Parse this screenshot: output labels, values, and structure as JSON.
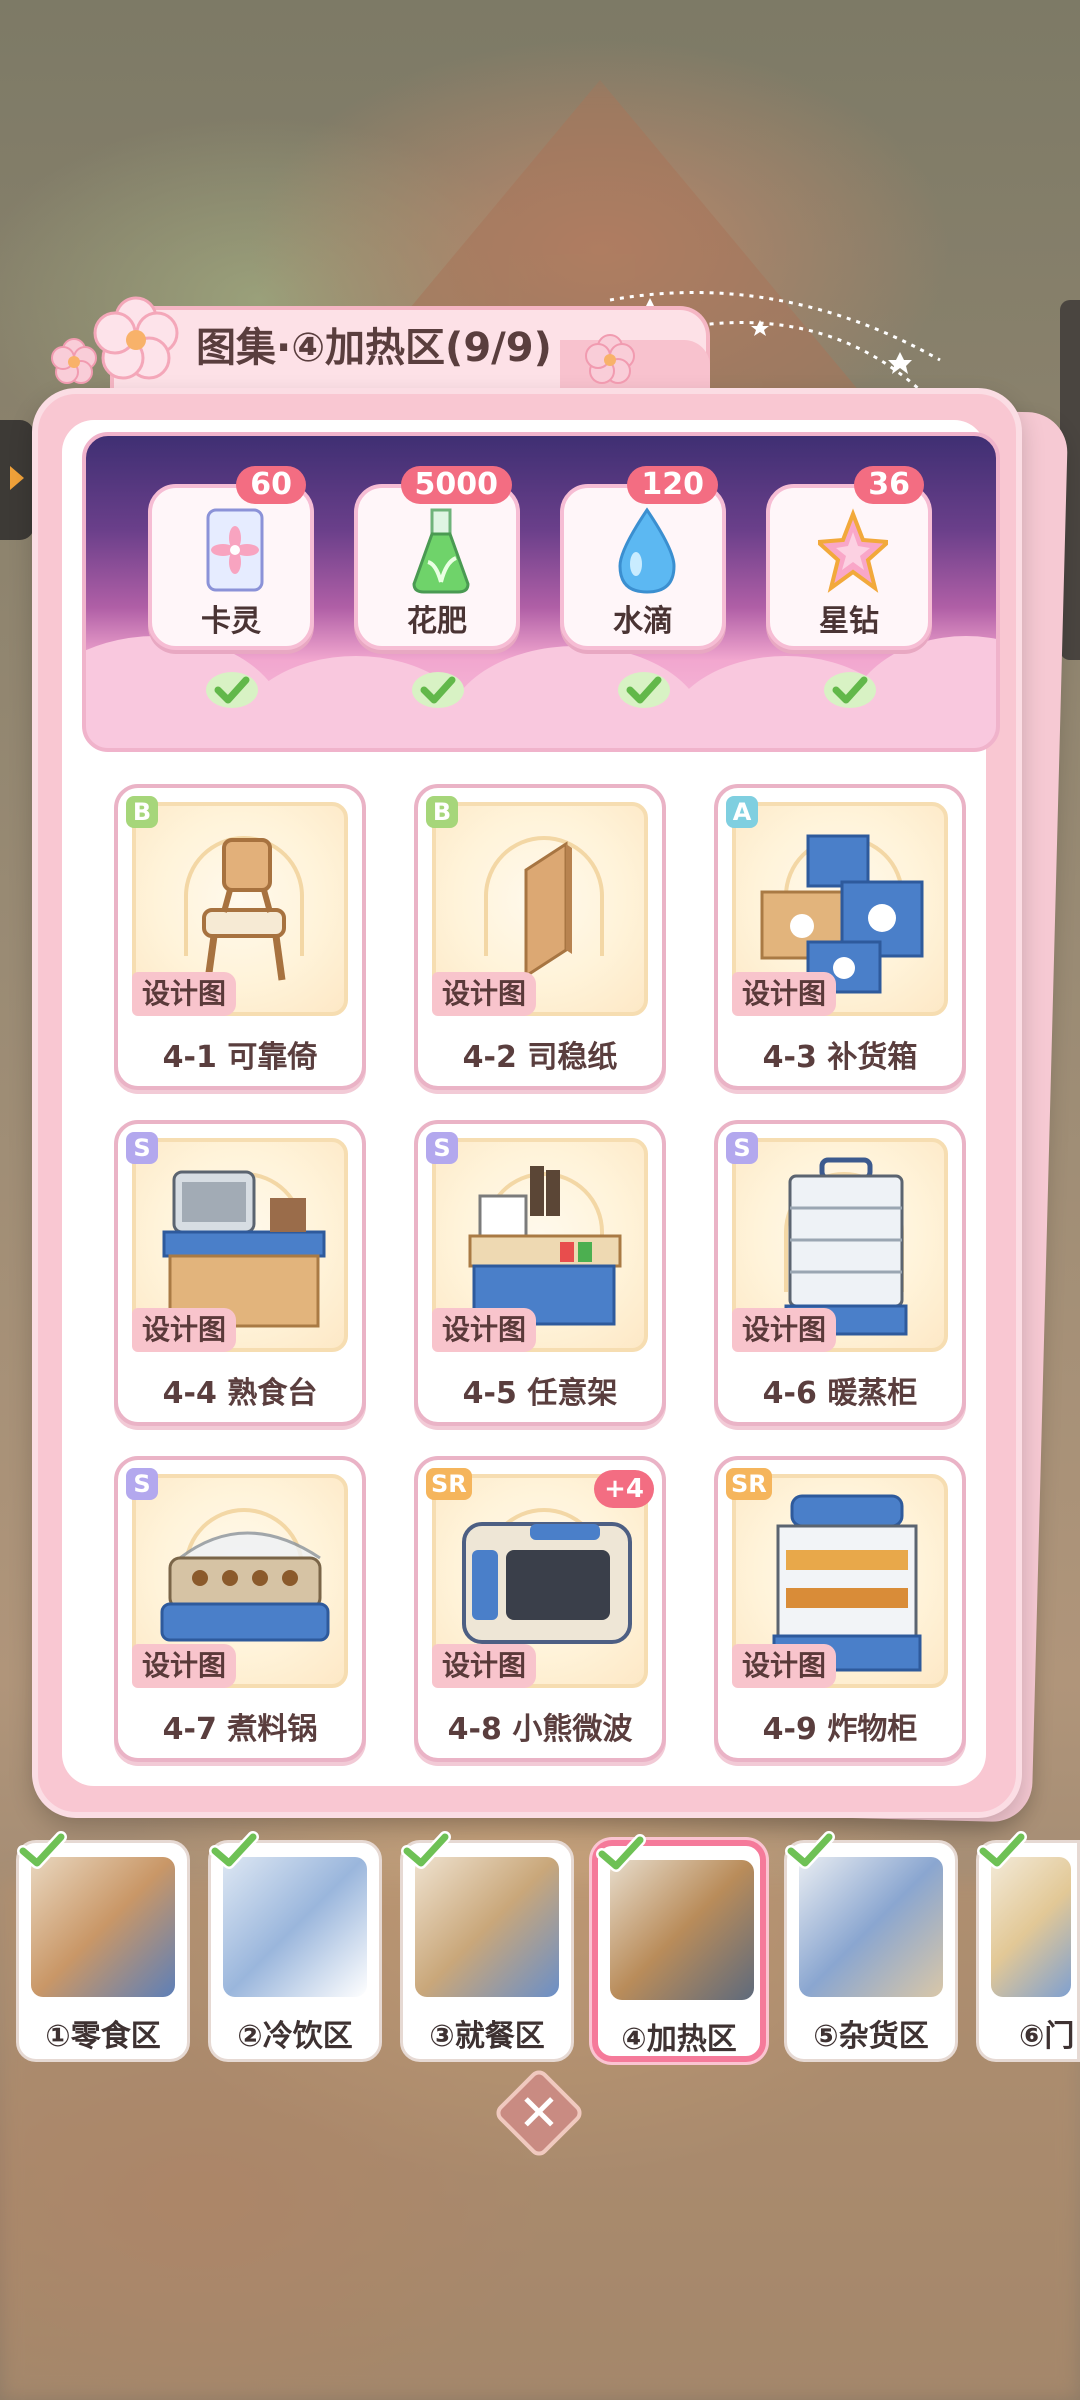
{
  "title": "图集·④加热区(9/9)",
  "rewards": [
    {
      "label": "卡灵",
      "count": "60",
      "icon": "card-icon",
      "claimed": true
    },
    {
      "label": "花肥",
      "count": "5000",
      "icon": "fertilizer-flask-icon",
      "claimed": true
    },
    {
      "label": "水滴",
      "count": "120",
      "icon": "water-drop-icon",
      "claimed": true
    },
    {
      "label": "星钻",
      "count": "36",
      "icon": "star-diamond-icon",
      "claimed": true
    }
  ],
  "items": [
    {
      "rarity": "B",
      "tag": "设计图",
      "name": "4-1 可靠倚",
      "icon": "chair-icon"
    },
    {
      "rarity": "B",
      "tag": "设计图",
      "name": "4-2 司稳纸",
      "icon": "board-icon"
    },
    {
      "rarity": "A",
      "tag": "设计图",
      "name": "4-3 补货箱",
      "icon": "boxes-icon"
    },
    {
      "rarity": "S",
      "tag": "设计图",
      "name": "4-4 熟食台",
      "icon": "deli-counter-icon"
    },
    {
      "rarity": "S",
      "tag": "设计图",
      "name": "4-5 任意架",
      "icon": "shelf-icon"
    },
    {
      "rarity": "S",
      "tag": "设计图",
      "name": "4-6 暖蒸柜",
      "icon": "steamer-cabinet-icon"
    },
    {
      "rarity": "S",
      "tag": "设计图",
      "name": "4-7 煮料锅",
      "icon": "oden-pot-icon"
    },
    {
      "rarity": "SR",
      "tag": "设计图",
      "name": "4-8 小熊微波",
      "icon": "microwave-icon",
      "badge": "+4"
    },
    {
      "rarity": "SR",
      "tag": "设计图",
      "name": "4-9 炸物柜",
      "icon": "fryer-cabinet-icon"
    }
  ],
  "zones": [
    {
      "label": "①零食区",
      "completed": true,
      "active": false
    },
    {
      "label": "②冷饮区",
      "completed": true,
      "active": false
    },
    {
      "label": "③就餐区",
      "completed": true,
      "active": false
    },
    {
      "label": "④加热区",
      "completed": true,
      "active": true
    },
    {
      "label": "⑤杂货区",
      "completed": true,
      "active": false
    },
    {
      "label": "⑥门",
      "completed": true,
      "active": false
    }
  ],
  "close_icon": "close-icon"
}
